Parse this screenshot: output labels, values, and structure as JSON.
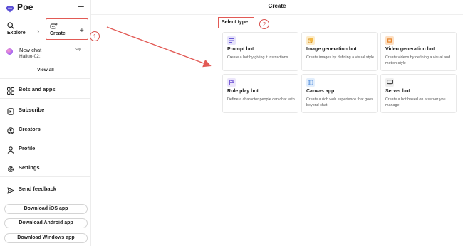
{
  "app": {
    "name": "Poe"
  },
  "sidebar": {
    "explore_label": "Explore",
    "create_label": "Create",
    "chats": [
      {
        "title": "New chat",
        "subtitle": "Hailuo-02:",
        "date": "Sep 11"
      }
    ],
    "view_all": "View all",
    "menu": [
      {
        "label": "Bots and apps",
        "icon": "grid-icon"
      },
      {
        "label": "Subscribe",
        "icon": "subscribe-icon"
      },
      {
        "label": "Creators",
        "icon": "creators-icon"
      },
      {
        "label": "Profile",
        "icon": "profile-icon"
      },
      {
        "label": "Settings",
        "icon": "settings-icon"
      },
      {
        "label": "Send feedback",
        "icon": "send-icon"
      }
    ],
    "downloads": [
      "Download iOS app",
      "Download Android app",
      "Download Windows app"
    ]
  },
  "main": {
    "title": "Create",
    "select_type": "Select type",
    "cards": [
      {
        "title": "Prompt bot",
        "desc": "Create a bot by giving it instructions",
        "icon": "prompt-icon",
        "color": "#e6e3fb"
      },
      {
        "title": "Image generation bot",
        "desc": "Create images by defining a visual style",
        "icon": "image-icon",
        "color": "#fdecc8"
      },
      {
        "title": "Video generation bot",
        "desc": "Create videos by defining a visual and motion style",
        "icon": "video-icon",
        "color": "#fde0c4"
      },
      {
        "title": "Role play bot",
        "desc": "Define a character people can chat with",
        "icon": "flag-icon",
        "color": "#ece6fb"
      },
      {
        "title": "Canvas app",
        "desc": "Create a rich web experience that goes beyond chat",
        "icon": "canvas-icon",
        "color": "#e2eefc"
      },
      {
        "title": "Server bot",
        "desc": "Create a bot based on a server you manage",
        "icon": "monitor-icon",
        "color": "#efefef"
      }
    ]
  },
  "annotations": {
    "step1": "1",
    "step2": "2"
  },
  "colors": {
    "annotation": "#e25a55",
    "border": "#e8e8e8"
  }
}
